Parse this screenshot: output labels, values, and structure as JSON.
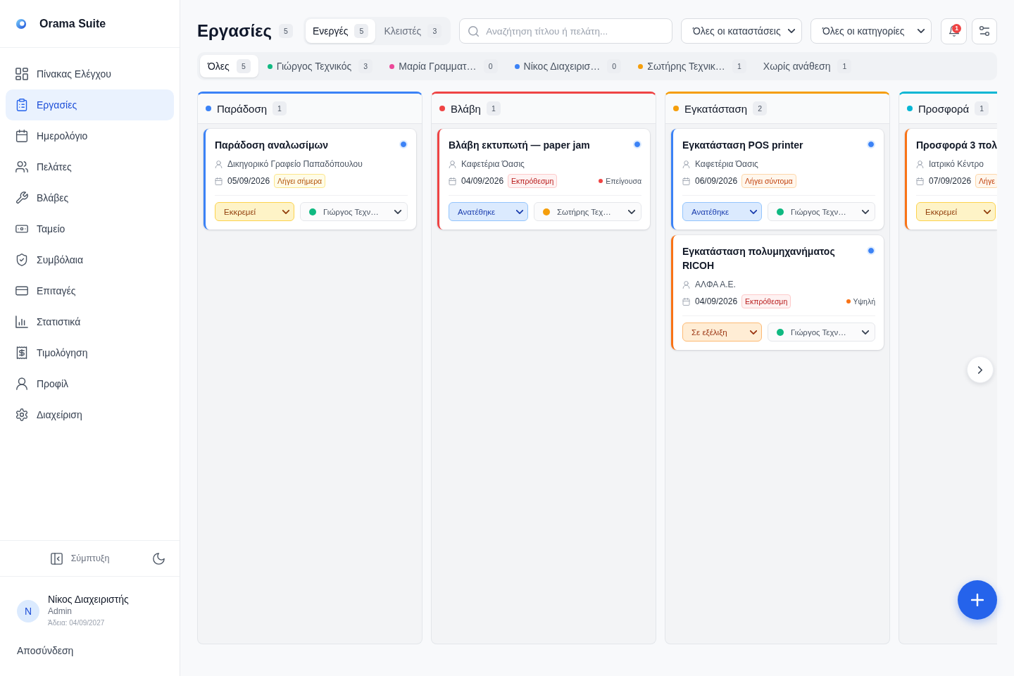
{
  "sidebar": {
    "brand": "Orama Suite",
    "nav": [
      {
        "label": "Πίνακας Ελέγχου",
        "selected": false
      },
      {
        "label": "Εργασίες",
        "selected": true
      },
      {
        "label": "Ημερολόγιο",
        "selected": false
      },
      {
        "label": "Πελάτες",
        "selected": false
      },
      {
        "label": "Βλάβες",
        "selected": false
      },
      {
        "label": "Ταμείο",
        "selected": false
      },
      {
        "label": "Συμβόλαια",
        "selected": false
      },
      {
        "label": "Επιταγές",
        "selected": false
      },
      {
        "label": "Στατιστικά",
        "selected": false
      },
      {
        "label": "Τιμολόγηση",
        "selected": false
      },
      {
        "label": "Προφίλ",
        "selected": false
      },
      {
        "label": "Διαχείριση",
        "selected": false
      }
    ],
    "collapse_label": "Σύμπτυξη",
    "user": {
      "initial": "N",
      "name": "Νίκος Διαχειριστής",
      "role": "Admin",
      "license": "Άδεια: 04/09/2027"
    },
    "logout": "Αποσύνδεση"
  },
  "header": {
    "title": "Εργασίες",
    "count": "5",
    "tabs": [
      {
        "label": "Ενεργές",
        "count": "5",
        "selected": true
      },
      {
        "label": "Κλειστές",
        "count": "3",
        "selected": false
      }
    ],
    "search": {
      "placeholder": "Αναζήτηση τίτλου ή πελάτη..."
    },
    "filters": [
      "Όλες οι καταστάσεις",
      "Όλες οι κατηγορίες"
    ],
    "notifications": "1"
  },
  "assignee_filters": [
    {
      "label": "Όλες",
      "count": "5",
      "selected": true
    },
    {
      "label": "Γιώργος Τεχνικός",
      "count": "3",
      "selected": false,
      "color": "#10b981"
    },
    {
      "label": "Μαρία Γραμματ…",
      "count": "0",
      "selected": false,
      "color": "#ec4899"
    },
    {
      "label": "Νίκος Διαχειρισ…",
      "count": "0",
      "selected": false,
      "color": "#3b82f6"
    },
    {
      "label": "Σωτήρης Τεχνικ…",
      "count": "1",
      "selected": false,
      "color": "#f59e0b"
    },
    {
      "label": "Χωρίς ανάθεση",
      "count": "1",
      "selected": false
    }
  ],
  "board": {
    "columns": [
      {
        "title": "Παράδοση",
        "count": "1",
        "color": "#3b82f6",
        "cards": [
          {
            "title": "Παράδοση αναλωσίμων",
            "color": "#3b82f6",
            "unread": true,
            "client": "Δικηγορικό Γραφείο Παπαδόπουλου",
            "date": "05/09/2026",
            "deadline": {
              "text": "Λήγει σήμερα",
              "kind": "today"
            },
            "status": {
              "text": "Εκκρεμεί",
              "kind": "pending"
            },
            "assignee": {
              "name": "Γιώργος Τεχν…",
              "color": "#10b981"
            }
          }
        ]
      },
      {
        "title": "Βλάβη",
        "count": "1",
        "color": "#ef4444",
        "cards": [
          {
            "title": "Βλάβη εκτυπωτή — paper jam",
            "color": "#ef4444",
            "unread": true,
            "client": "Καφετέρια Όασις",
            "date": "04/09/2026",
            "deadline": {
              "text": "Εκπρόθεσμη",
              "kind": "overdue"
            },
            "priority": {
              "text": "Επείγουσα",
              "color": "#ef4444"
            },
            "status": {
              "text": "Ανατέθηκε",
              "kind": "assigned"
            },
            "assignee": {
              "name": "Σωτήρης Τεχ…",
              "color": "#f59e0b"
            }
          }
        ]
      },
      {
        "title": "Εγκατάσταση",
        "count": "2",
        "color": "#f59e0b",
        "cards": [
          {
            "title": "Εγκατάσταση POS printer",
            "color": "#3b82f6",
            "unread": true,
            "client": "Καφετέρια Όασις",
            "date": "06/09/2026",
            "deadline": {
              "text": "Λήγει σύντομα",
              "kind": "soon"
            },
            "status": {
              "text": "Ανατέθηκε",
              "kind": "assigned"
            },
            "assignee": {
              "name": "Γιώργος Τεχν…",
              "color": "#10b981"
            }
          },
          {
            "title": "Εγκατάσταση πολυμηχανήματος RICOH",
            "color": "#f97316",
            "unread": true,
            "client": "ΑΛΦΑ Α.Ε.",
            "date": "04/09/2026",
            "deadline": {
              "text": "Εκπρόθεσμη",
              "kind": "overdue"
            },
            "priority": {
              "text": "Υψηλή",
              "color": "#f97316"
            },
            "status": {
              "text": "Σε εξέλιξη",
              "kind": "progress"
            },
            "assignee": {
              "name": "Γιώργος Τεχν…",
              "color": "#10b981"
            }
          }
        ]
      },
      {
        "title": "Προσφορά",
        "count": "1",
        "color": "#06b6d4",
        "cards": [
          {
            "title": "Προσφορά 3 πολ",
            "color": "#f97316",
            "client": "Ιατρικό Κέντρο",
            "date": "07/09/2026",
            "deadline": {
              "text": "Λήγε",
              "kind": "soon"
            },
            "status": {
              "text": "Εκκρεμεί",
              "kind": "pending"
            }
          }
        ]
      }
    ]
  }
}
